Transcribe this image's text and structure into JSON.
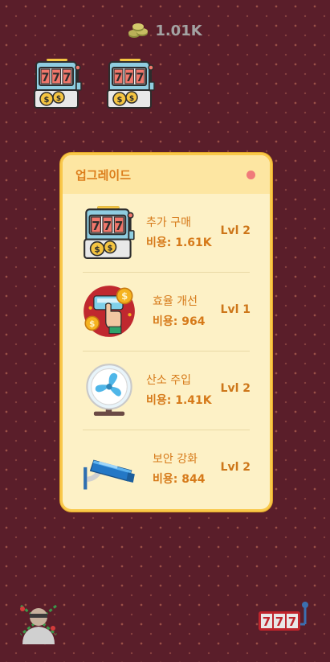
{
  "header": {
    "coin_icon": "coins-icon",
    "coins": "1.01K"
  },
  "owned_machines": [
    {
      "icon": "slot-machine-icon"
    },
    {
      "icon": "slot-machine-icon"
    }
  ],
  "upgrade_panel": {
    "title": "업그레이드",
    "items": [
      {
        "icon": "slot-machine-icon",
        "name": "추가 구매",
        "cost_label": "비용: ",
        "cost": "1.61K",
        "level": "Lvl 2"
      },
      {
        "icon": "tap-coin-icon",
        "name": "효율 개선",
        "cost_label": "비용: ",
        "cost": "964",
        "level": "Lvl 1"
      },
      {
        "icon": "fan-icon",
        "name": "산소 주입",
        "cost_label": "비용: ",
        "cost": "1.41K",
        "level": "Lvl 2"
      },
      {
        "icon": "security-camera-icon",
        "name": "보안 강화",
        "cost_label": "비용: ",
        "cost": "844",
        "level": "Lvl 2"
      }
    ]
  },
  "footer": {
    "left_icon": "thief-icon",
    "right_icon": "slot-777-icon"
  },
  "colors": {
    "background": "#5a1e2a",
    "panel": "#fdf1c6",
    "panel_border": "#f9c84a",
    "accent": "#dc7d1b"
  }
}
